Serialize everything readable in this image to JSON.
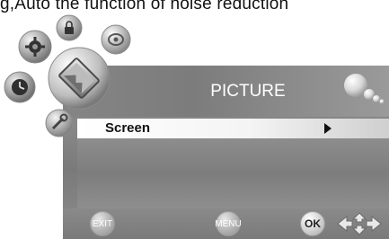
{
  "caption": {
    "text": "g,Auto the function of noise reduction"
  },
  "menu": {
    "title": "PICTURE",
    "items": [
      {
        "label": "Screen"
      }
    ]
  },
  "footer": {
    "exit_label": "EXIT",
    "menu_label": "MENU",
    "ok_label": "OK"
  },
  "icons": [
    "lock-icon",
    "picture-icon",
    "sound-icon",
    "settings-icon",
    "clock-icon",
    "tools-icon",
    "bubbles-icon",
    "navigation-arrows-icon"
  ]
}
